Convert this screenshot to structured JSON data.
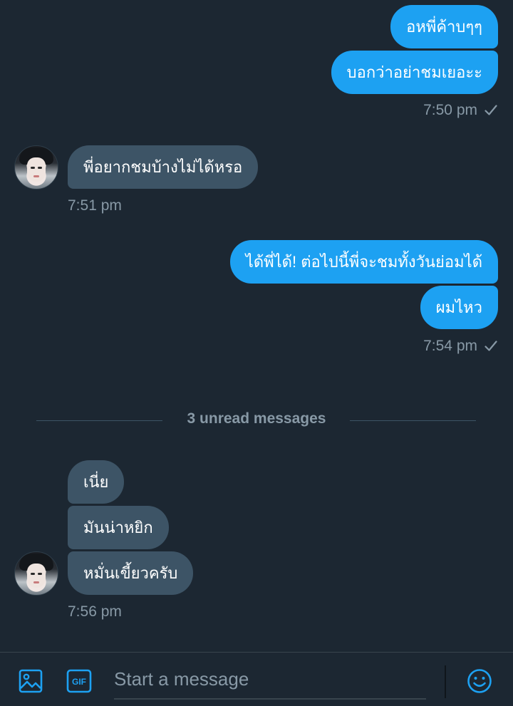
{
  "colors": {
    "background": "#1c2732",
    "outgoing_bubble": "#1da1f2",
    "incoming_bubble": "#3d5466",
    "meta_text": "#8899a6",
    "accent": "#1da1f2"
  },
  "messages": {
    "group1": {
      "m1": "อหพี่ค้าบๆๆ",
      "m2": "บอกว่าอย่าชมเยอะะ",
      "time": "7:50 pm"
    },
    "group2": {
      "m1": "พี่อยากชมบ้างไม่ได้หรอ",
      "time": "7:51 pm"
    },
    "group3": {
      "m1": "ได้พี่ได้! ต่อไปนี้พี่จะชมทั้งวันย่อมได้",
      "m2": "ผมไหว",
      "time": "7:54 pm"
    },
    "unread_divider": "3 unread messages",
    "group4": {
      "m1": "เนี่ย",
      "m2": "มันน่าหยิก",
      "m3": "หมั่นเขี้ยวครับ",
      "time": "7:56 pm"
    }
  },
  "composer": {
    "placeholder": "Start a message",
    "gif_label": "GIF",
    "icons": [
      "image-icon",
      "gif-icon",
      "emoji-icon"
    ]
  },
  "status_icons": {
    "sent": "checkmark-icon"
  }
}
